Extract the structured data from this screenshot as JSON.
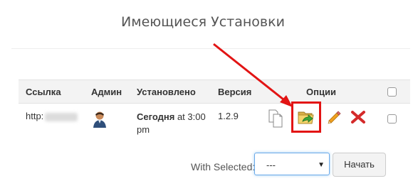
{
  "page": {
    "title": "Имеющиеся Установки"
  },
  "table": {
    "headers": {
      "link": "Ссылка",
      "admin": "Админ",
      "installed": "Установлено",
      "version": "Версия",
      "options": "Опции"
    },
    "rows": [
      {
        "link_prefix": "http:",
        "installed_bold": "Сегодня",
        "installed_rest_1": " at 3:00",
        "installed_rest_2": "pm",
        "version": "1.2.9",
        "icons": [
          "copy-icon",
          "clone-icon",
          "edit-icon",
          "delete-icon"
        ]
      }
    ]
  },
  "bulk": {
    "label": "With Selected:",
    "select_value": "---",
    "button_label": "Начать"
  },
  "colors": {
    "highlight": "#e21414",
    "arrow": "#e21414"
  }
}
